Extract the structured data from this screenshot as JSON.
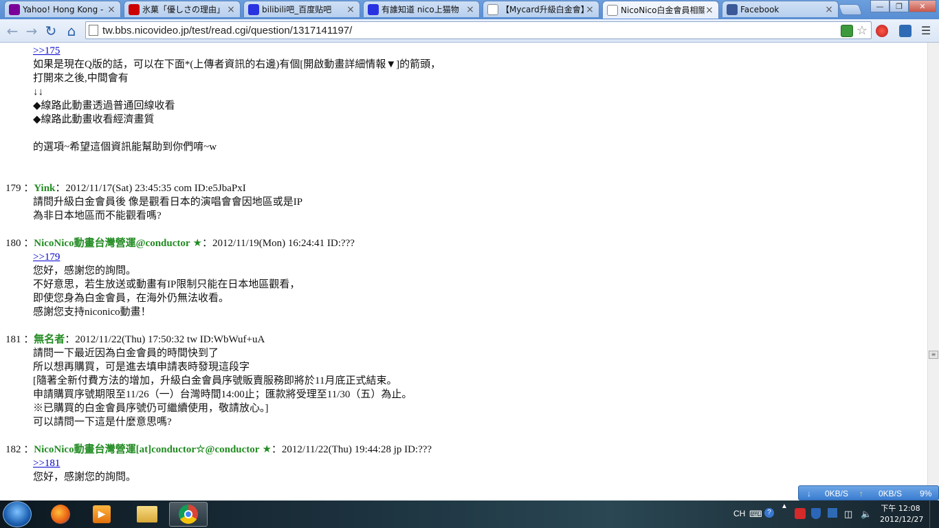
{
  "browser": {
    "tabs": [
      {
        "label": "Yahoo! Hong Kong - 雅",
        "favicon": "yahoo-icon",
        "color": "#7b0099"
      },
      {
        "label": "氷菓「優しさの理由」",
        "favicon": "youtube-icon",
        "color": "#cc0000"
      },
      {
        "label": "bilibili吧_百度贴吧",
        "favicon": "baidu-icon",
        "color": "#2932e1"
      },
      {
        "label": "有誰知道 nico上猫物",
        "favicon": "baidu-icon",
        "color": "#2932e1"
      },
      {
        "label": "【Mycard升級白金會】",
        "favicon": "page-icon",
        "color": "#ffffff"
      },
      {
        "label": "NicoNico白金會員相關",
        "favicon": "page-icon",
        "color": "#ffffff",
        "active": true
      },
      {
        "label": "Facebook",
        "favicon": "facebook-icon",
        "color": "#3b5998"
      }
    ],
    "url": "tw.bbs.nicovideo.jp/test/read.cgi/question/1317141197/"
  },
  "thread": {
    "top_lines": [
      {
        "reply": ">>175"
      },
      {
        "text": "如果是現在Q版的話，可以在下面*(上傳者資訊的右邊)有個[開啟動畫詳細情報▼]的箭頭，"
      },
      {
        "text": "打開來之後,中間會有"
      },
      {
        "text": "↓↓"
      },
      {
        "text": "◆線路此動畫透過普通回線收看"
      },
      {
        "text": "◆線路此動畫收看經濟畫質"
      },
      {
        "text": ""
      },
      {
        "text": "的選項~希望這個資訊能幫助到你們唷~w"
      }
    ],
    "posts": [
      {
        "number": "179",
        "name": "Yink",
        "star": "",
        "meta": "：2012/11/17(Sat) 23:45:35 com ID:e5JbaPxI",
        "lines": [
          {
            "text": "請問升級白金會員後 像是觀看日本的演唱會會因地區或是IP"
          },
          {
            "text": "為非日本地區而不能觀看嗎?"
          }
        ]
      },
      {
        "number": "180",
        "name": "NicoNico動畫台灣營運@conductor",
        "star": "★",
        "meta": "：2012/11/19(Mon) 16:24:41 ID:???",
        "lines": [
          {
            "reply": ">>179"
          },
          {
            "text": "您好，感謝您的詢問。"
          },
          {
            "text": "不好意思，若生放送或動畫有IP限制只能在日本地區觀看，"
          },
          {
            "text": "即使您身為白金會員，在海外仍無法收看。"
          },
          {
            "text": "感謝您支持niconico動畫！"
          }
        ]
      },
      {
        "number": "181",
        "name": "無名者",
        "star": "",
        "meta": "：2012/11/22(Thu) 17:50:32 tw ID:WbWuf+uA",
        "lines": [
          {
            "text": "請問一下最近因為白金會員的時間快到了"
          },
          {
            "text": "所以想再購買，可是進去填申請表時發現這段字"
          },
          {
            "text": "[隨著全新付費方法的增加，升級白金會員序號販賣服務即將於11月底正式結束。"
          },
          {
            "text": "申請購買序號期限至11/26（一）台灣時間14:00止；匯款將受理至11/30（五）為止。"
          },
          {
            "text": "※已購買的白金會員序號仍可繼續使用，敬請放心。]"
          },
          {
            "text": "可以請問一下這是什麼意思嗎?"
          }
        ]
      },
      {
        "number": "182",
        "name": "NicoNico動畫台灣營運[at]conductor☆@conductor",
        "star": "★",
        "meta": "：2012/11/22(Thu) 19:44:28 jp ID:???",
        "lines": [
          {
            "reply": ">>181"
          },
          {
            "text": "您好，感謝您的詢問。"
          }
        ]
      }
    ]
  },
  "netspeed": {
    "down": "0KB/S",
    "up": "0KB/S",
    "cpu": "9%"
  },
  "taskbar": {
    "lang": "CH",
    "time": "下午 12:08",
    "date": "2012/12/27",
    "apps": [
      "firefox-icon",
      "media-player-icon",
      "file-explorer-icon",
      "chrome-icon"
    ]
  },
  "colors": {
    "name_green": "#228b22",
    "link_blue": "#0000cc",
    "chrome_blue": "#3f78c8"
  }
}
